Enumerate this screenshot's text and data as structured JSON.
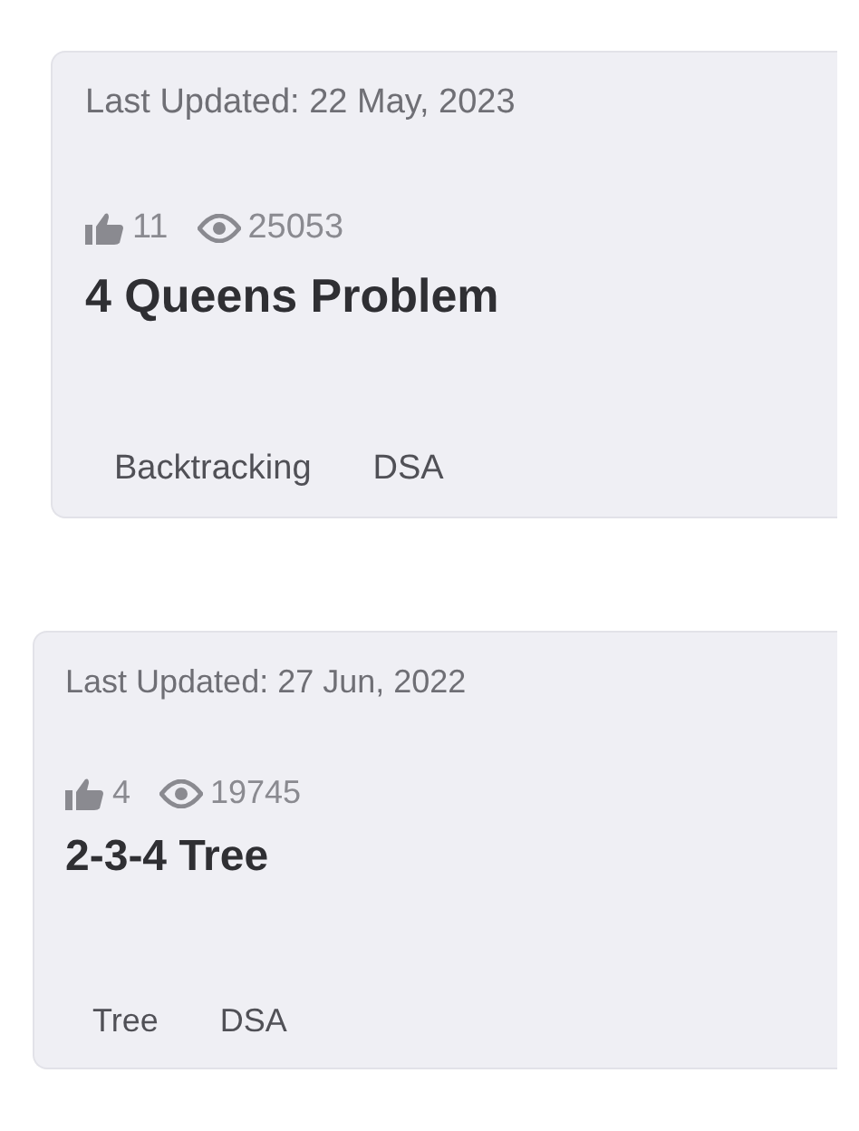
{
  "articles": [
    {
      "last_updated": "Last Updated: 22 May, 2023",
      "likes": "11",
      "views": "25053",
      "title": "4 Queens Problem",
      "tags": [
        "Backtracking",
        "DSA"
      ]
    },
    {
      "last_updated": "Last Updated: 27 Jun, 2022",
      "likes": "4",
      "views": "19745",
      "title": "2-3-4 Tree",
      "tags": [
        "Tree",
        "DSA"
      ]
    }
  ]
}
